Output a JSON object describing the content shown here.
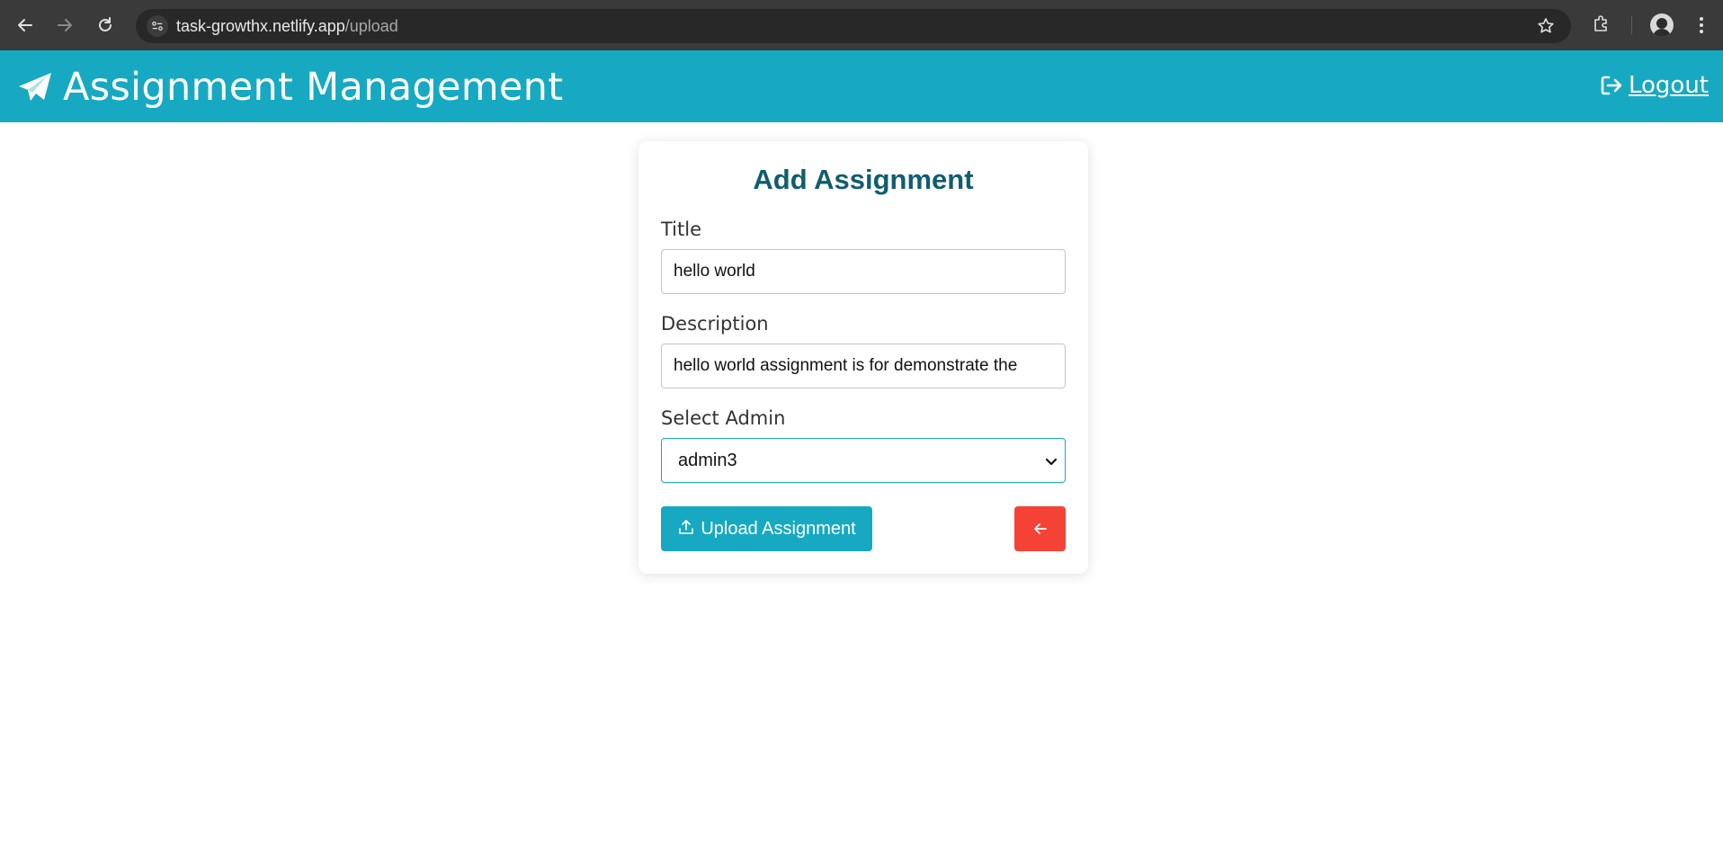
{
  "browser": {
    "url_host": "task-growthx.netlify.app",
    "url_path": "/upload",
    "icons": [
      "back-icon",
      "forward-icon",
      "reload-icon",
      "site-info-icon",
      "bookmark-star-icon",
      "extensions-icon",
      "profile-avatar",
      "more-menu-icon"
    ]
  },
  "header": {
    "title": "Assignment Management",
    "logout_label": "Logout",
    "background": "#17a9c2",
    "icons": [
      "paper-plane-icon",
      "logout-icon"
    ]
  },
  "form": {
    "title": "Add Assignment",
    "title_color": "#105d6e",
    "title_label": "Title",
    "title_value": "hello world",
    "description_label": "Description",
    "description_value": "hello world assignment is for demonstrate the",
    "admin_label": "Select Admin",
    "admin_selected": "admin3",
    "upload_button_label": "Upload Assignment",
    "upload_button_color": "#17a9c2",
    "back_button_color": "#f44336",
    "icons": [
      "upload-icon",
      "arrow-left-icon",
      "chevron-down-icon"
    ]
  }
}
